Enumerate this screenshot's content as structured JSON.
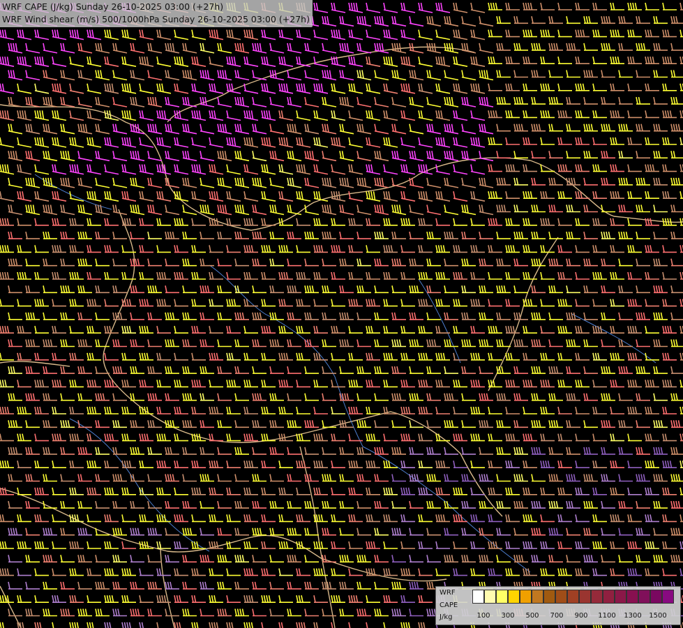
{
  "title": {
    "line1": "WRF CAPE (J/kg) Sunday 26-10-2025 03:00 (+27h)",
    "line2": "WRF Wind shear (m/s) 500/1000hPa Sunday 26-10-2025 03:00 (+27h)"
  },
  "legend": {
    "name_lines": [
      "WRF",
      "CAPE",
      "J/kg"
    ],
    "colors": [
      "#ffffff",
      "#fffbb0",
      "#ffff66",
      "#ffd400",
      "#f0a000",
      "#c07820",
      "#a05a10",
      "#a04d18",
      "#a04024",
      "#9a3530",
      "#952a3a",
      "#902040",
      "#8a1848",
      "#881050",
      "#80105a",
      "#7a0860",
      "#880a80"
    ],
    "tick_labels": [
      "100",
      "300",
      "500",
      "700",
      "900",
      "1100",
      "1300",
      "1500"
    ]
  },
  "map": {
    "description_icon": "wind-barb-icon",
    "shear_color_classes": [
      "#ff44ff",
      "#ff7070",
      "#f08070",
      "#d0906a",
      "#c89070",
      "#ffff33",
      "#ffff66",
      "#b080d0",
      "#9060c0"
    ]
  }
}
